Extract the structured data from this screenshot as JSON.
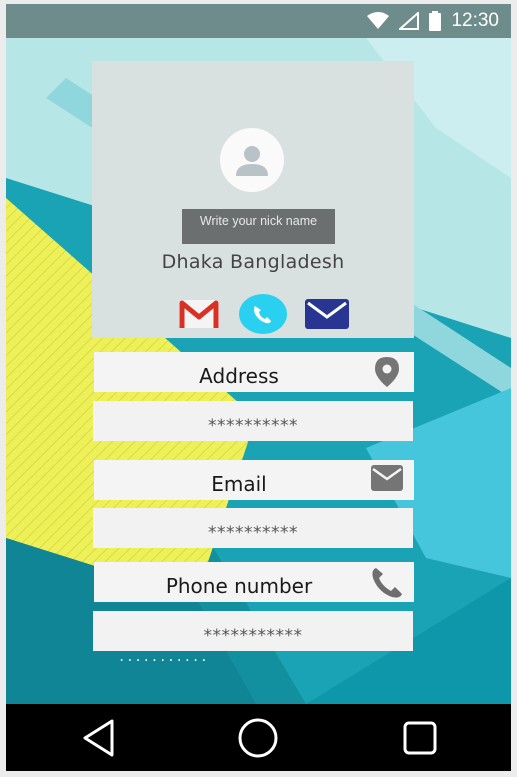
{
  "status_bar": {
    "time": "12:30",
    "icons": [
      "wifi-icon",
      "signal-icon",
      "battery-icon"
    ]
  },
  "profile": {
    "avatar_icon": "person-icon",
    "nick_placeholder": "Write your nick name",
    "location": "Dhaka Bangladesh",
    "contact_icons": [
      "gmail-icon",
      "phone-icon",
      "mail-icon"
    ]
  },
  "fields": [
    {
      "label": "Address",
      "icon": "location-pin-icon",
      "value_placeholder": "**********"
    },
    {
      "label": "Email",
      "icon": "envelope-icon",
      "value_placeholder": "**********"
    },
    {
      "label": "Phone number",
      "icon": "phone-icon",
      "value_placeholder": "***********"
    }
  ],
  "stray_text": "...........",
  "nav_bar": {
    "buttons": [
      "back-icon",
      "home-icon",
      "recents-icon"
    ]
  },
  "colors": {
    "status_bar": "#6f8c8c",
    "card": "#d8e1e0",
    "nick_input": "#6b6f6f",
    "phone_accent": "#29b6f6",
    "mail_accent": "#283593",
    "gmail_red": "#d93025"
  }
}
